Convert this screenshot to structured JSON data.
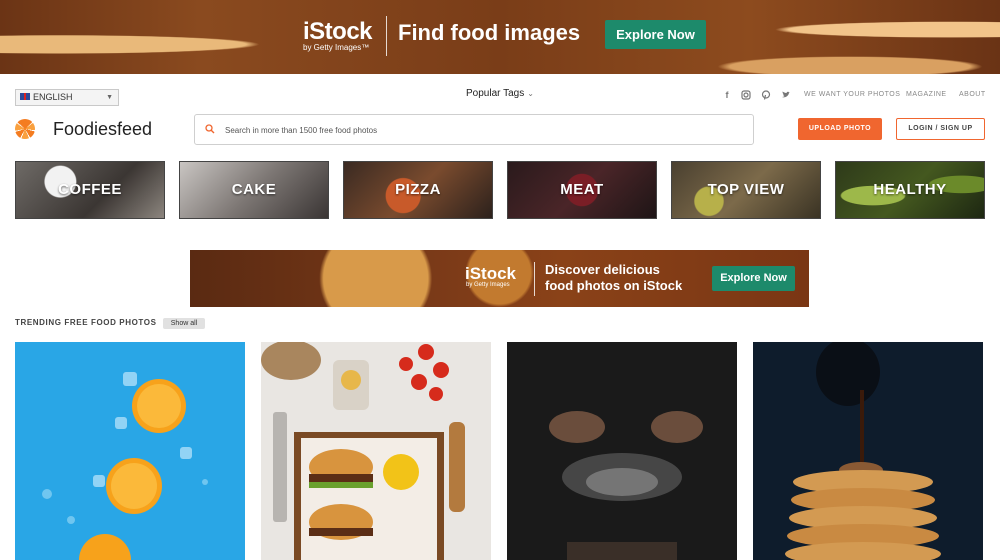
{
  "banner": {
    "logo": "iStock",
    "logo_sub": "by Getty Images™",
    "headline": "Find food images",
    "button": "Explore Now"
  },
  "header": {
    "language": "ENGLISH",
    "popular_tags": "Popular Tags",
    "links": [
      "WE WANT YOUR PHOTOS",
      "MAGAZINE",
      "ABOUT"
    ],
    "social_icons": [
      "facebook-icon",
      "instagram-icon",
      "pinterest-icon",
      "twitter-icon"
    ]
  },
  "brand": {
    "name": "Foodiesfeed"
  },
  "search": {
    "placeholder": "Search in more than 1500 free food photos",
    "value": ""
  },
  "actions": {
    "upload": "UPLOAD PHOTO",
    "login": "LOGIN / SIGN UP"
  },
  "categories": [
    "COFFEE",
    "CAKE",
    "PIZZA",
    "MEAT",
    "TOP VIEW",
    "HEALTHY"
  ],
  "ad": {
    "logo": "iStock",
    "logo_sub": "by Getty Images",
    "line1": "Discover delicious",
    "line2": "food photos on iStock",
    "button": "Explore Now"
  },
  "trending": {
    "title": "TRENDING FREE FOOD PHOTOS",
    "show_all": "Show all"
  },
  "colors": {
    "accent": "#f0662f",
    "istock_green": "#1d8a6b"
  }
}
